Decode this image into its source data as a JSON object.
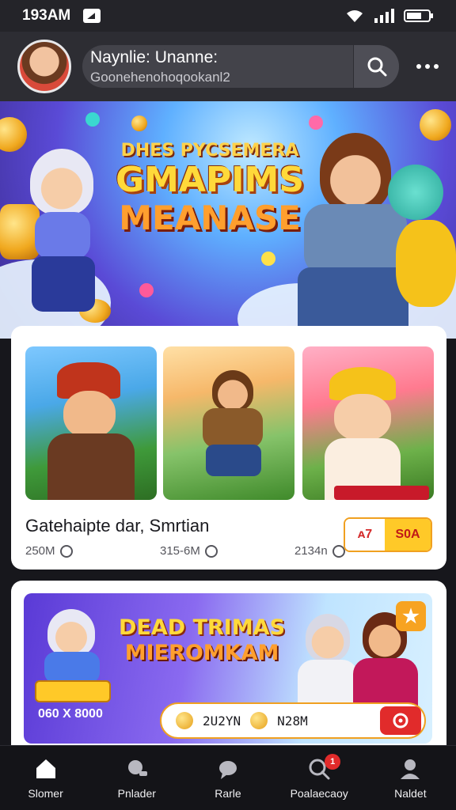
{
  "status_bar": {
    "time": "193AM"
  },
  "header": {
    "title": "Naynlie: Unanne:",
    "subtitle": "Goonehenohoqookanl2"
  },
  "hero": {
    "line1": "DHES PYCSEMERA",
    "line2": "GMAPIMS",
    "line3": "MEANASE"
  },
  "game_card": {
    "title": "Gatehaipte dar, Smrtian",
    "stats": [
      "250M",
      "315-6M",
      "2134n"
    ],
    "price_old": "ᴀ7",
    "price_new": "S0A"
  },
  "promo": {
    "line1": "DEAD TRIMAS",
    "line2": "MIEROMKAM",
    "caption": "060 X 8000",
    "value_1": "2U2YN",
    "value_2": "N28M"
  },
  "bottom_nav": [
    {
      "label": "Slomer",
      "icon": "home-icon"
    },
    {
      "label": "Pnlader",
      "icon": "controller-icon"
    },
    {
      "label": "Rarle",
      "icon": "chat-icon"
    },
    {
      "label": "Poalaecaoy",
      "icon": "search-icon",
      "badge": "1"
    },
    {
      "label": "Naldet",
      "icon": "profile-icon"
    }
  ],
  "colors": {
    "accent": "#ffc928",
    "danger": "#e12b2b",
    "nav_bg": "#141418"
  }
}
